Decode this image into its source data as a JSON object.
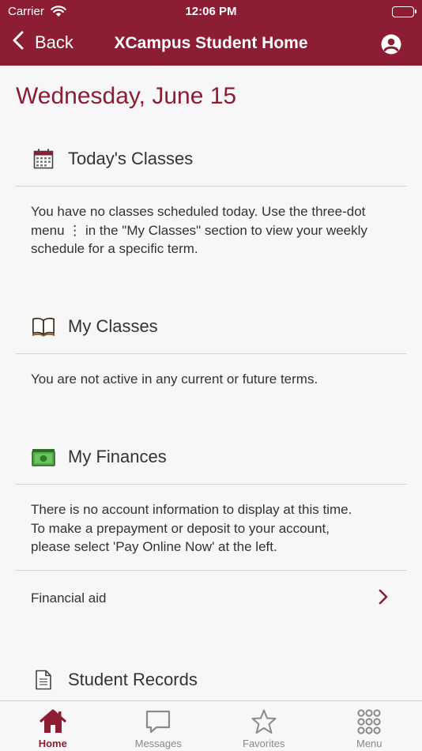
{
  "status_bar": {
    "carrier": "Carrier",
    "time": "12:06 PM"
  },
  "nav": {
    "back_label": "Back",
    "title": "XCampus Student Home"
  },
  "date_heading": "Wednesday, June 15",
  "sections": {
    "todays_classes": {
      "title": "Today's Classes",
      "icon": "calendar-icon",
      "line1": "You have no classes scheduled today. Use the three-dot",
      "line2": "menu ⋮ in the \"My Classes\" section to view your weekly",
      "line3": "schedule for a specific term."
    },
    "my_classes": {
      "title": "My Classes",
      "icon": "book-icon",
      "line1": "You are not active in any current or future terms."
    },
    "my_finances": {
      "title": "My Finances",
      "icon": "money-icon",
      "line1": "There is no account information to display at this time.",
      "line2": "To make a prepayment or deposit to your account,",
      "line3": "please select 'Pay Online Now' at the left.",
      "financial_aid_label": "Financial aid"
    },
    "student_records": {
      "title": "Student Records",
      "icon": "document-icon"
    }
  },
  "tabs": [
    {
      "label": "Home",
      "icon": "home-icon",
      "active": true
    },
    {
      "label": "Messages",
      "icon": "chat-icon",
      "active": false
    },
    {
      "label": "Favorites",
      "icon": "star-icon",
      "active": false
    },
    {
      "label": "Menu",
      "icon": "grid-icon",
      "active": false
    }
  ],
  "colors": {
    "brand": "#8c1d32",
    "background": "#f7f7f7",
    "text": "#333333",
    "divider": "#d6d6d6",
    "inactive_tab": "#8a8a8a"
  }
}
